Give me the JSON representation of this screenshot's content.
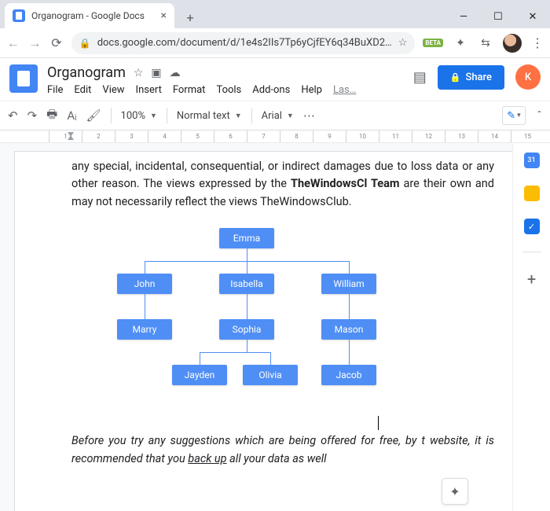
{
  "browser": {
    "tab_title": "Organogram - Google Docs",
    "url": "docs.google.com/document/d/1e4s2IIs7Tp6yCjfEY6q34BuXD2…"
  },
  "doc": {
    "title": "Organogram",
    "menus": [
      "File",
      "Edit",
      "View",
      "Insert",
      "Format",
      "Tools",
      "Add-ons",
      "Help"
    ],
    "last": "Las…",
    "share": "Share",
    "avatar_letter": "K"
  },
  "toolbar": {
    "zoom": "100%",
    "style": "Normal text",
    "font": "Arial"
  },
  "body": {
    "para1_a": "any special, incidental, consequential, or indirect damages due to loss data or any other reason. The views expressed by the ",
    "para1_bold": "TheWindowsCl Team",
    "para1_b": " are their own and may not necessarily reflect the views TheWindowsClub.",
    "para2_a": "Before you try any suggestions which are being offered for free, by t website, it is recommended that you ",
    "para2_u": "back up",
    "para2_b": " all your data as well "
  },
  "chart_data": {
    "type": "tree",
    "root": "Emma",
    "children": {
      "Emma": [
        "John",
        "Isabella",
        "William"
      ],
      "John": [
        "Marry"
      ],
      "Isabella": [
        "Sophia"
      ],
      "William": [
        "Mason"
      ],
      "Sophia": [
        "Jayden",
        "Olivia"
      ],
      "Mason": [
        "Jacob"
      ]
    },
    "nodes": [
      "Emma",
      "John",
      "Isabella",
      "William",
      "Marry",
      "Sophia",
      "Mason",
      "Jayden",
      "Olivia",
      "Jacob"
    ]
  },
  "ruler": {
    "max": 15
  }
}
